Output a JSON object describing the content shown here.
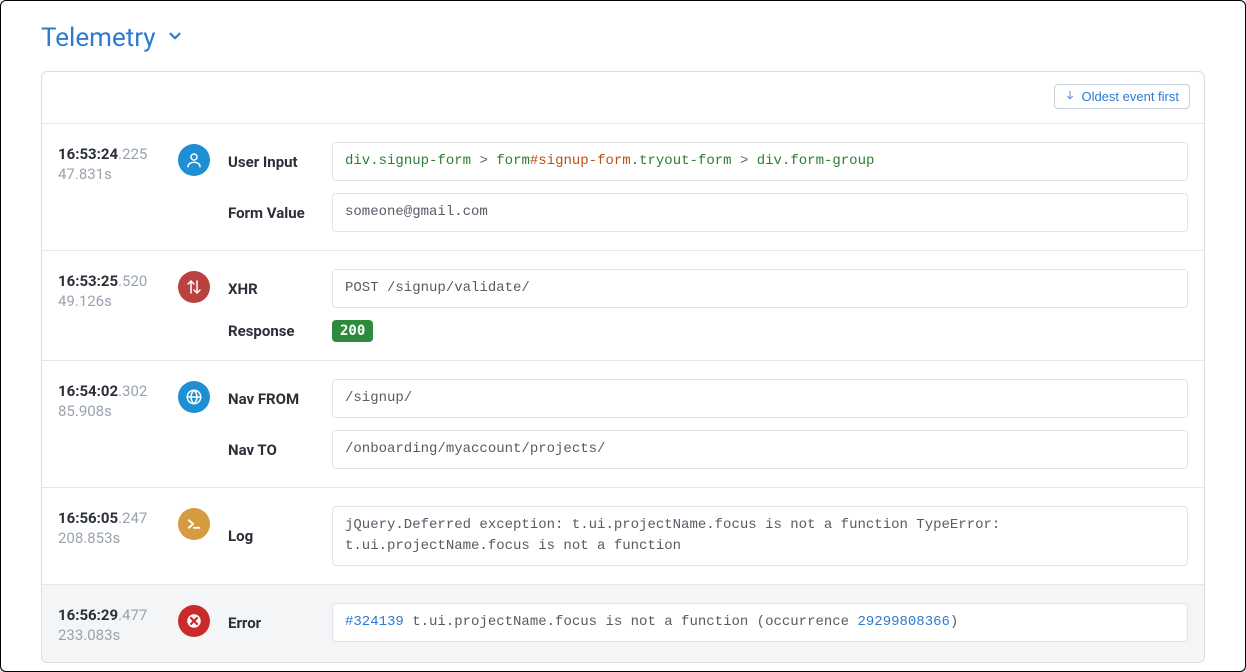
{
  "title": "Telemetry",
  "sort_button": "Oldest event first",
  "events": [
    {
      "time": "16:53:24",
      "time_ms": ".225",
      "offset": "47.831s",
      "icon": "user",
      "icon_color": "blue",
      "rows": [
        {
          "label": "User Input",
          "type": "selectorbox",
          "selector": {
            "parts": [
              {
                "tag": "div",
                "cls": ".signup-form"
              },
              {
                "tag": "form",
                "id": "#signup-form",
                "cls": ".tryout-form"
              },
              {
                "tag": "div",
                "cls": ".form-group"
              }
            ]
          }
        },
        {
          "label": "Form Value",
          "type": "textbox",
          "text": "someone@gmail.com"
        }
      ]
    },
    {
      "time": "16:53:25",
      "time_ms": ".520",
      "offset": "49.126s",
      "icon": "xhr",
      "icon_color": "red",
      "rows": [
        {
          "label": "XHR",
          "type": "textbox",
          "text": "POST /signup/validate/"
        },
        {
          "label": "Response",
          "type": "badge",
          "text": "200"
        }
      ]
    },
    {
      "time": "16:54:02",
      "time_ms": ".302",
      "offset": "85.908s",
      "icon": "globe",
      "icon_color": "blue",
      "rows": [
        {
          "label": "Nav FROM",
          "type": "textbox",
          "text": "/signup/"
        },
        {
          "label": "Nav TO",
          "type": "textbox",
          "text": "/onboarding/myaccount/projects/"
        }
      ]
    },
    {
      "time": "16:56:05",
      "time_ms": ".247",
      "offset": "208.853s",
      "icon": "log",
      "icon_color": "brown",
      "rows": [
        {
          "label": "Log",
          "type": "textbox",
          "text": "jQuery.Deferred exception: t.ui.projectName.focus is not a function TypeError: t.ui.projectName.focus is not a function"
        }
      ]
    },
    {
      "time": "16:56:29",
      "time_ms": ".477",
      "offset": "233.083s",
      "icon": "error",
      "icon_color": "error",
      "highlight": true,
      "rows": [
        {
          "label": "Error",
          "type": "errorbox",
          "link1": "#324139",
          "middle": " t.ui.projectName.focus is not a function (occurrence ",
          "link2": "29299808366",
          "tail": ")"
        }
      ]
    }
  ]
}
